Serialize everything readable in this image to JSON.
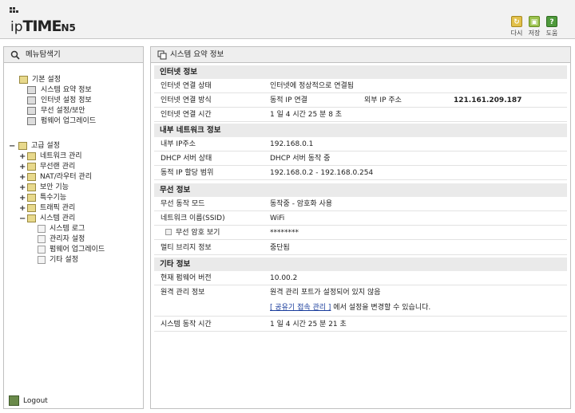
{
  "header": {
    "logo_ip": "ip",
    "logo_time": "TIME",
    "logo_model": "N5",
    "buttons": [
      {
        "label": "다시",
        "icon": "refresh-icon",
        "color": "#e2c04a"
      },
      {
        "label": "저장",
        "icon": "save-icon",
        "color": "#9bc24d"
      },
      {
        "label": "도움",
        "icon": "help-icon",
        "color": "#4f9a3c"
      }
    ]
  },
  "left": {
    "title": "메뉴탐색기",
    "basic": {
      "label": "기본 설정",
      "expander": "",
      "items": [
        "시스템 요약 정보",
        "인터넷 설정 정보",
        "무선 설정/보안",
        "펌웨어 업그레이드"
      ]
    },
    "advanced": {
      "label": "고급 설정",
      "expander": "−",
      "items": [
        {
          "label": "네트워크 관리",
          "expander": "+"
        },
        {
          "label": "무선랜 관리",
          "expander": "+"
        },
        {
          "label": "NAT/라우터 관리",
          "expander": "+"
        },
        {
          "label": "보안 기능",
          "expander": "+"
        },
        {
          "label": "특수기능",
          "expander": "+"
        },
        {
          "label": "트래픽 관리",
          "expander": "+"
        },
        {
          "label": "시스템 관리",
          "expander": "−"
        }
      ],
      "system_children": [
        "시스템 로그",
        "관리자 설정",
        "펌웨어 업그레이드",
        "기타 설정"
      ]
    },
    "logout": "Logout"
  },
  "main": {
    "title": "시스템 요약 정보",
    "internet": {
      "header": "인터넷 정보",
      "status_label": "인터넷 연결 상태",
      "status_value": "인터넷에 정상적으로 연결됨",
      "method_label": "인터넷 연결 방식",
      "method_value": "동적 IP 연결",
      "external_ip_label": "외부 IP 주소",
      "external_ip_value": "121.161.209.187",
      "time_label": "인터넷 연결 시간",
      "time_value": "1 일 4 시간 25 분 8 초"
    },
    "internal": {
      "header": "내부 네트워크 정보",
      "ip_label": "내부 IP주소",
      "ip_value": "192.168.0.1",
      "dhcp_label": "DHCP 서버 상태",
      "dhcp_value": "DHCP 서버 동작 중",
      "range_label": "동적 IP 할당 범위",
      "range_value": "192.168.0.2 -  192.168.0.254"
    },
    "wireless": {
      "header": "무선 정보",
      "mode_label": "무선 동작 모드",
      "mode_value": "동작중 - 암호화 사용",
      "ssid_label": "네트워크 이름(SSID)",
      "ssid_value": "WiFi",
      "pw_label": "무선 암호 보기",
      "pw_value": "********",
      "bridge_label": "멀티 브리지 정보",
      "bridge_value": "중단됨"
    },
    "other": {
      "header": "기타 정보",
      "fw_label": "현재 펌웨어 버전",
      "fw_value": "10.00.2",
      "remote_label": "원격 관리 정보",
      "remote_value": "원격 관리 포트가 설정되어 있지 않음",
      "remote_link": "[ 공유기 접속 관리 ]",
      "remote_suffix": " 에서 설정을 변경할 수 있습니다.",
      "uptime_label": "시스템 동작 시간",
      "uptime_value": "1 일 4 시간 25 분 21 초"
    }
  }
}
